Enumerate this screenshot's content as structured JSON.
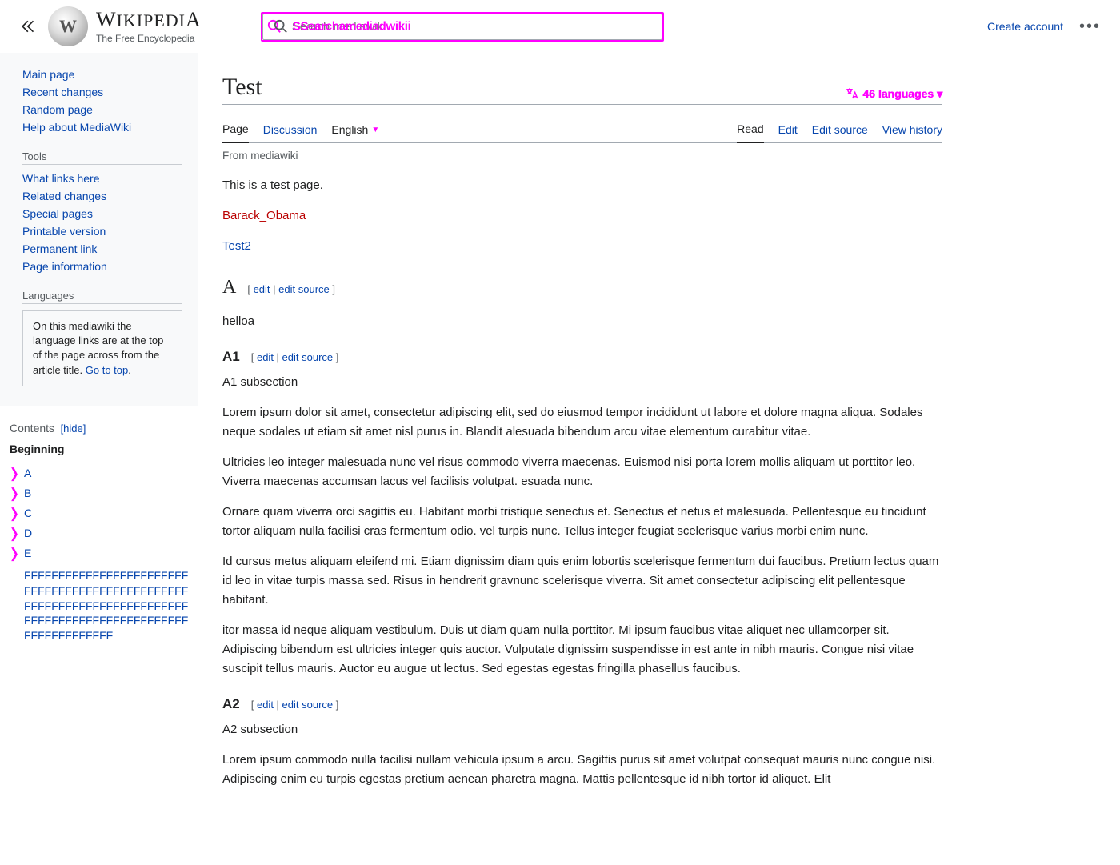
{
  "header": {
    "logo_word": "WIKIPEDIA",
    "logo_tag": "The Free Encyclopedia",
    "search_placeholder": "Search mediawiki",
    "search_overlay_text": "SSearchamediadwikii",
    "create_account": "Create account"
  },
  "sidebar": {
    "nav": [
      "Main page",
      "Recent changes",
      "Random page",
      "Help about MediaWiki"
    ],
    "tools_heading": "Tools",
    "tools": [
      "What links here",
      "Related changes",
      "Special pages",
      "Printable version",
      "Permanent link",
      "Page information"
    ],
    "lang_heading": "Languages",
    "lang_box_text": "On this mediawiki the language links are at the top of the page across from the article title. ",
    "lang_box_link": "Go to top",
    "lang_box_period": "."
  },
  "toc": {
    "heading": "Contents",
    "hide": "[hide]",
    "beginning": "Beginning",
    "items": [
      "A",
      "B",
      "C",
      "D",
      "E"
    ],
    "long_item": "FFFFFFFFFFFFFFFFFFFFFFFFFFFFFFFFFFFFFFFFFFFFFFFFFFFFFFFFFFFFFFFFFFFFFFFFFFFFFFFFFFFFFFFFFFFFFFFFFFFFFFFFFFFFF"
  },
  "page": {
    "title": "Test",
    "lang_button": "46 languages",
    "tabs_left": {
      "page": "Page",
      "discussion": "Discussion",
      "english": "English"
    },
    "tabs_right": {
      "read": "Read",
      "edit": "Edit",
      "edit_source": "Edit source",
      "history": "View history"
    },
    "from": "From mediawiki",
    "intro": "This is a test page.",
    "link_red": "Barack_Obama",
    "link_blue": "Test2",
    "sec_A": {
      "h": "A",
      "text": "helloa"
    },
    "sec_A1": {
      "h": "A1",
      "sub": "A1 subsection",
      "p1": "Lorem ipsum dolor sit amet, consectetur adipiscing elit, sed do eiusmod tempor incididunt ut labore et dolore magna aliqua. Sodales neque sodales ut etiam sit amet nisl purus in. Blandit alesuada bibendum arcu vitae elementum curabitur vitae.",
      "p2": "Ultricies leo integer malesuada nunc vel risus commodo viverra maecenas. Euismod nisi porta lorem mollis aliquam ut porttitor leo. Viverra maecenas accumsan lacus vel facilisis volutpat. esuada nunc.",
      "p3": "Ornare quam viverra orci sagittis eu. Habitant morbi tristique senectus et. Senectus et netus et malesuada. Pellentesque eu tincidunt tortor aliquam nulla facilisi cras fermentum odio. vel turpis nunc. Tellus integer feugiat scelerisque varius morbi enim nunc.",
      "p4": "Id cursus metus aliquam eleifend mi. Etiam dignissim diam quis enim lobortis scelerisque fermentum dui faucibus. Pretium lectus quam id leo in vitae turpis massa sed. Risus in hendrerit gravnunc scelerisque viverra. Sit amet consectetur adipiscing elit pellentesque habitant.",
      "p5": "itor massa id neque aliquam vestibulum. Duis ut diam quam nulla porttitor. Mi ipsum faucibus vitae aliquet nec ullamcorper sit. Adipiscing bibendum est ultricies integer quis auctor. Vulputate dignissim suspendisse in est ante in nibh mauris. Congue nisi vitae suscipit tellus mauris. Auctor eu augue ut lectus. Sed egestas egestas fringilla phasellus faucibus."
    },
    "sec_A2": {
      "h": "A2",
      "sub": "A2 subsection",
      "p1": "Lorem ipsum commodo nulla facilisi nullam vehicula ipsum a arcu. Sagittis purus sit amet volutpat consequat mauris nunc congue nisi. Adipiscing enim eu turpis egestas pretium aenean pharetra magna. Mattis pellentesque id nibh tortor id aliquet. Elit"
    },
    "editsec": {
      "open": "[ ",
      "edit": "edit",
      "sep": " | ",
      "src": "edit source",
      "close": " ]"
    }
  }
}
